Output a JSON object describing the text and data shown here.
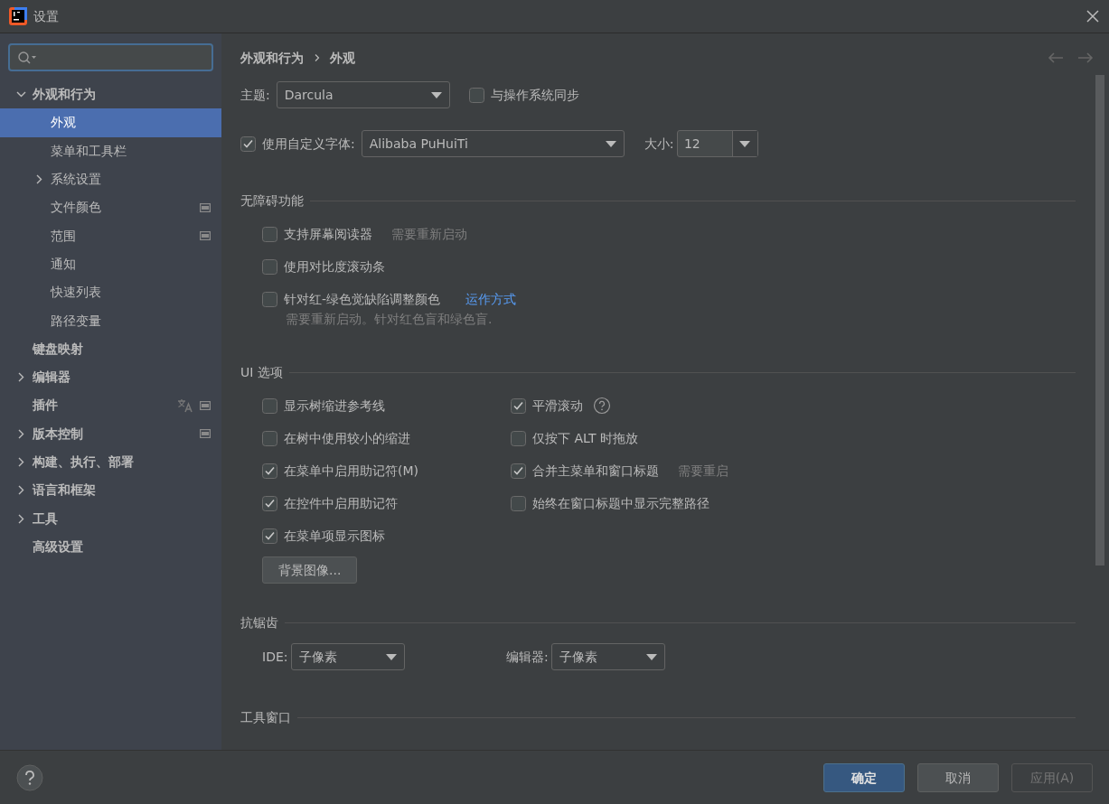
{
  "window": {
    "title": "设置"
  },
  "sidebar": {
    "items": [
      {
        "label": "外观和行为",
        "selected": false,
        "expanded": true,
        "children": [
          {
            "label": "外观",
            "selected": true
          },
          {
            "label": "菜单和工具栏",
            "selected": false
          },
          {
            "label": "系统设置",
            "selected": false,
            "expanded": false
          },
          {
            "label": "文件颜色",
            "selected": false,
            "project_scope": true
          },
          {
            "label": "范围",
            "selected": false,
            "project_scope": true
          },
          {
            "label": "通知",
            "selected": false
          },
          {
            "label": "快速列表",
            "selected": false
          },
          {
            "label": "路径变量",
            "selected": false
          }
        ]
      },
      {
        "label": "键盘映射",
        "selected": false
      },
      {
        "label": "编辑器",
        "selected": false,
        "expanded": false
      },
      {
        "label": "插件",
        "selected": false,
        "translated": true,
        "project_scope": true
      },
      {
        "label": "版本控制",
        "selected": false,
        "expanded": false,
        "project_scope": true
      },
      {
        "label": "构建、执行、部署",
        "selected": false,
        "expanded": false
      },
      {
        "label": "语言和框架",
        "selected": false,
        "expanded": false
      },
      {
        "label": "工具",
        "selected": false,
        "expanded": false
      },
      {
        "label": "高级设置",
        "selected": false
      }
    ]
  },
  "breadcrumb": [
    "外观和行为",
    "外观"
  ],
  "theme": {
    "label": "主题:",
    "value": "Darcula",
    "sync": {
      "label": "与操作系统同步",
      "checked": false
    }
  },
  "font": {
    "label": "使用自定义字体:",
    "checked": true,
    "value": "Alibaba PuHuiTi",
    "size_label": "大小:",
    "size": "12"
  },
  "sections": [
    {
      "title": "无障碍功能",
      "kind": "list",
      "items": [
        {
          "label": "支持屏幕阅读器",
          "checked": false,
          "note": "需要重新启动"
        },
        {
          "label": "使用对比度滚动条",
          "checked": false
        },
        {
          "label": "针对红-绿色觉缺陷调整颜色",
          "checked": false,
          "link": "运作方式",
          "hint": "需要重新启动。针对红色盲和绿色盲."
        }
      ]
    },
    {
      "title": "UI 选项",
      "kind": "columns",
      "columns": [
        [
          {
            "label": "显示树缩进参考线",
            "checked": false
          },
          {
            "label": "在树中使用较小的缩进",
            "checked": false
          },
          {
            "label": "在菜单中启用助记符(M)",
            "checked": true
          },
          {
            "label": "在控件中启用助记符",
            "checked": true
          },
          {
            "label": "在菜单项显示图标",
            "checked": true
          }
        ],
        [
          {
            "label": "平滑滚动",
            "checked": true,
            "help": true
          },
          {
            "label": "仅按下 ALT 时拖放",
            "checked": false
          },
          {
            "label": "合并主菜单和窗口标题",
            "checked": true,
            "note": "需要重启"
          },
          {
            "label": "始终在窗口标题中显示完整路径",
            "checked": false
          }
        ]
      ],
      "button": "背景图像..."
    },
    {
      "title": "抗锯齿",
      "kind": "dropdowns",
      "fields": [
        {
          "label": "IDE:",
          "value": "子像素"
        },
        {
          "label": "编辑器:",
          "value": "子像素"
        }
      ]
    },
    {
      "title": "工具窗口",
      "kind": "list"
    }
  ],
  "footer": {
    "buttons": [
      {
        "label": "确定",
        "primary": true,
        "disabled": false
      },
      {
        "label": "取消",
        "primary": false,
        "disabled": false
      },
      {
        "label": "应用(A)",
        "primary": false,
        "disabled": true
      }
    ]
  }
}
